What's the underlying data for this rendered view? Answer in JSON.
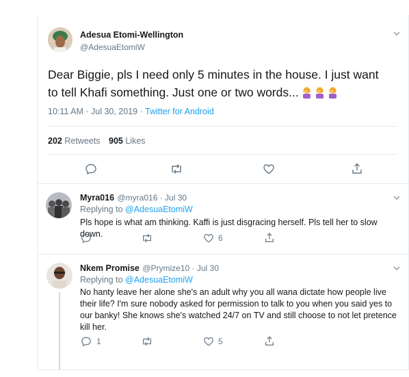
{
  "main_tweet": {
    "author_name": "Adesua Etomi-Wellington",
    "author_handle": "@AdesuaEtomiW",
    "text": "Dear Biggie, pls I need only 5 minutes in the house. I just want to tell Khafi something. Just one or two words...",
    "emoji": [
      "woman-facepalming-icon",
      "woman-facepalming-icon",
      "woman-facepalming-icon"
    ],
    "time": "10:11 AM · Jul 30, 2019 · ",
    "source": "Twitter for Android",
    "retweets_count": "202",
    "retweets_label": "Retweets",
    "likes_count": "905",
    "likes_label": "Likes"
  },
  "replies": [
    {
      "author_name": "Myra016",
      "author_handle": "@myra016 · Jul 30",
      "replying_prefix": "Replying to ",
      "replying_to": "@AdesuaEtomiW",
      "text": "Pls hope is what am thinking. Kaffi is just disgracing herself. Pls tell her to slow down.",
      "reply_count": "",
      "retweet_count": "",
      "like_count": "6"
    },
    {
      "author_name": "Nkem Promise",
      "author_handle": "@Prymize10 · Jul 30",
      "replying_prefix": "Replying to ",
      "replying_to": "@AdesuaEtomiW",
      "text": "No hanty leave her alone she's an adult why you all wana dictate how people live their life? I'm sure nobody asked for permission to talk to you when you said yes to our banky! She knows she's watched 24/7 on TV and still choose to not let pretence kill her.",
      "reply_count": "1",
      "retweet_count": "",
      "like_count": "5"
    }
  ],
  "colors": {
    "accent": "#1da1f2",
    "secondary_text": "#657786",
    "border": "#e6ecf0"
  }
}
